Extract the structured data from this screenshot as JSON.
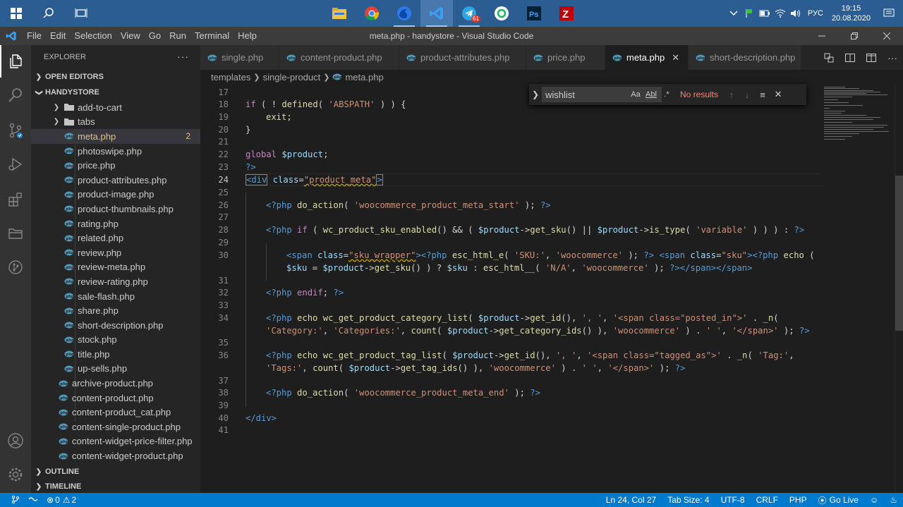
{
  "taskbar": {
    "language": "РУС",
    "time": "19:15",
    "date": "20.08.2020",
    "telegram_badge": "61"
  },
  "window": {
    "title": "meta.php - handystore - Visual Studio Code",
    "menu": [
      "File",
      "Edit",
      "Selection",
      "View",
      "Go",
      "Run",
      "Terminal",
      "Help"
    ]
  },
  "sidebar": {
    "header": "EXPLORER",
    "more": "···",
    "open_editors": "OPEN EDITORS",
    "project": "HANDYSTORE",
    "folders": [
      "add-to-cart",
      "tabs"
    ],
    "files": [
      "meta.php",
      "photoswipe.php",
      "price.php",
      "product-attributes.php",
      "product-image.php",
      "product-thumbnails.php",
      "rating.php",
      "related.php",
      "review.php",
      "review-meta.php",
      "review-rating.php",
      "sale-flash.php",
      "share.php",
      "short-description.php",
      "stock.php",
      "title.php",
      "up-sells.php"
    ],
    "meta_badge": "2",
    "root_files": [
      "archive-product.php",
      "content-product.php",
      "content-product_cat.php",
      "content-single-product.php",
      "content-widget-price-filter.php",
      "content-widget-product.php"
    ],
    "outline": "OUTLINE",
    "timeline": "TIMELINE"
  },
  "tabs": [
    "single.php",
    "content-product.php",
    "product-attributes.php",
    "price.php",
    "meta.php",
    "short-description.php"
  ],
  "breadcrumb": [
    "templates",
    "single-product",
    "meta.php"
  ],
  "find": {
    "value": "wishlist",
    "result": "No results",
    "opt_case": "Aa",
    "opt_word": "Abl",
    "opt_regex": ".*"
  },
  "line_numbers": [
    "17",
    "18",
    "19",
    "20",
    "21",
    "22",
    "23",
    "24",
    "25",
    "26",
    "27",
    "28",
    "29",
    "30",
    "",
    "31",
    "32",
    "33",
    "34",
    "",
    "35",
    "36",
    "",
    "37",
    "38",
    "39",
    "40",
    "41"
  ],
  "code": {
    "l18": [
      "if",
      " ( ! ",
      "defined",
      "( ",
      "'ABSPATH'",
      " ) ) {"
    ],
    "l19": "exit;",
    "l20": "}",
    "l22": [
      "global",
      " ",
      "$product",
      ";"
    ],
    "l23": "?>",
    "l24": [
      "<div",
      " ",
      "class",
      "=",
      "\"product_meta\"",
      ">"
    ],
    "l26": [
      "<?php",
      " ",
      "do_action",
      "( ",
      "'woocommerce_product_meta_start'",
      " ); ",
      "?>"
    ],
    "l28": [
      "<?php",
      " ",
      "if",
      " ( ",
      "wc_product_sku_enabled",
      "() && ( ",
      "$product",
      "->",
      "get_sku",
      "() || ",
      "$product",
      "->",
      "is_type",
      "( ",
      "'variable'",
      " ) ) ) : ",
      "?>"
    ],
    "l30a": [
      "<span",
      " ",
      "class",
      "=",
      "\"sku_wrapper\"",
      "><?php",
      " ",
      "esc_html_e",
      "( ",
      "'SKU:'",
      ", ",
      "'woocommerce'",
      " ); ",
      "?>",
      " ",
      "<span",
      " ",
      "class",
      "=",
      "\"sku\"",
      "><?php",
      " ",
      "echo",
      " ("
    ],
    "l30b": [
      "$sku",
      " = ",
      "$product",
      "->",
      "get_sku",
      "() ) ? ",
      "$sku",
      " : ",
      "esc_html__",
      "( ",
      "'N/A'",
      ", ",
      "'woocommerce'",
      " ); ",
      "?></span></span>"
    ],
    "l32": [
      "<?php",
      " ",
      "endif",
      "; ",
      "?>"
    ],
    "l34a": [
      "<?php",
      " ",
      "echo",
      " ",
      "wc_get_product_category_list",
      "( ",
      "$product",
      "->",
      "get_id",
      "(), ",
      "', '",
      ", ",
      "'<span class=\"posted_in\">'",
      " . ",
      "_n",
      "("
    ],
    "l34b": [
      "'Category:'",
      ", ",
      "'Categories:'",
      ", ",
      "count",
      "( ",
      "$product",
      "->",
      "get_category_ids",
      "() ), ",
      "'woocommerce'",
      " ) . ",
      "' '",
      ", ",
      "'</span>'",
      " ); ",
      "?>"
    ],
    "l36a": [
      "<?php",
      " ",
      "echo",
      " ",
      "wc_get_product_tag_list",
      "( ",
      "$product",
      "->",
      "get_id",
      "(), ",
      "', '",
      ", ",
      "'<span class=\"tagged_as\">'",
      " . ",
      "_n",
      "( ",
      "'Tag:'",
      ","
    ],
    "l36b": [
      "'Tags:'",
      ", ",
      "count",
      "( ",
      "$product",
      "->",
      "get_tag_ids",
      "() ), ",
      "'woocommerce'",
      " ) . ",
      "' '",
      ", ",
      "'</span>'",
      " ); ",
      "?>"
    ],
    "l38": [
      "<?php",
      " ",
      "do_action",
      "( ",
      "'woocommerce_product_meta_end'",
      " ); ",
      "?>"
    ],
    "l40": "</div>"
  },
  "status": {
    "errors": "0",
    "warnings": "2",
    "position": "Ln 24, Col 27",
    "tab_size": "Tab Size: 4",
    "encoding": "UTF-8",
    "eol": "CRLF",
    "language": "PHP",
    "golive": "Go Live"
  },
  "colors": {
    "accent": "#007acc",
    "taskbar": "#2b5c92",
    "keyword": "#c586c0",
    "string": "#ce9178",
    "function": "#dcdcaa",
    "variable": "#9cdcfe",
    "tag": "#569cd6",
    "modified": "#e2c08d"
  }
}
